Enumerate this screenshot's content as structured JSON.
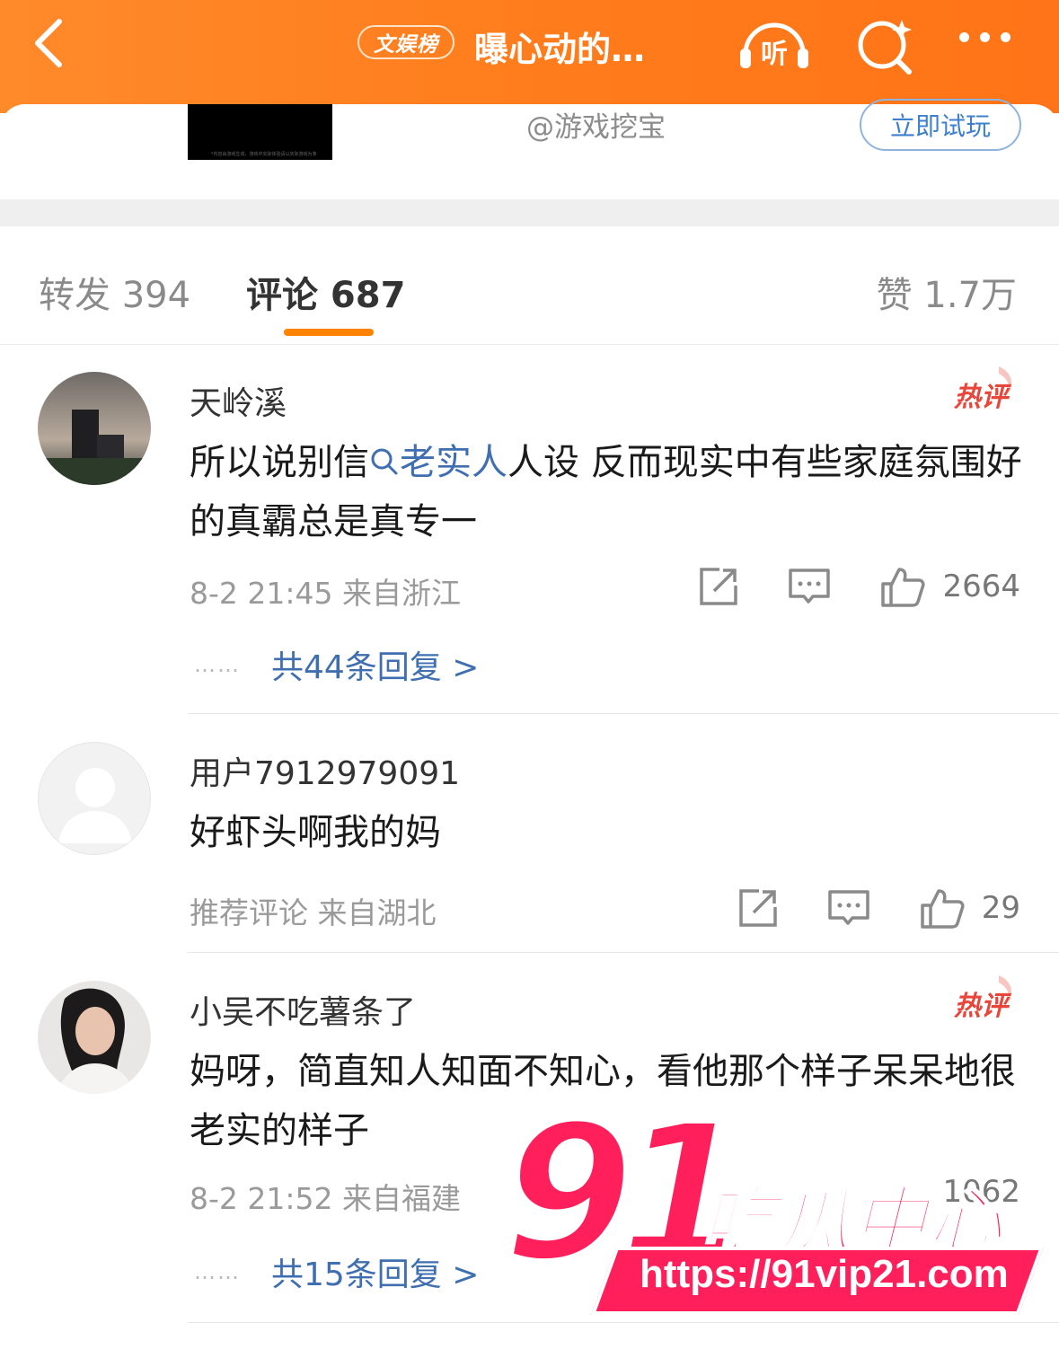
{
  "header": {
    "tag": "文娱榜",
    "title": "曝心动的…",
    "listen_icon_text": "听"
  },
  "promo": {
    "handle": "@游戏挖宝",
    "try_button": "立即试玩",
    "thumb_caption": "*内容由游戏生成，游戏中实际体验请以实际游戏为准"
  },
  "tabs": {
    "repost": "转发 394",
    "comment": "评论 687",
    "like": "赞 1.7万"
  },
  "comments": [
    {
      "user": "天岭溪",
      "hot_badge": "热评",
      "text_before": "所以说别信",
      "link_text": "老实人",
      "text_after": "人设 反而现实中有些家庭氛围好的真霸总是真专一",
      "meta": "8-2 21:45  来自浙江",
      "likes": "2664",
      "replies": "共44条回复 >"
    },
    {
      "user": "用户7912979091",
      "text": "好虾头啊我的妈",
      "meta": "推荐评论  来自湖北",
      "likes": "29"
    },
    {
      "user": "小吴不吃薯条了",
      "hot_badge": "热评",
      "text": "妈呀，简直知人知面不知心，看他那个样子呆呆地很老实的样子",
      "meta": "8-2 21:52  来自福建",
      "likes": "1062",
      "replies": "共15条回复 >"
    }
  ],
  "watermark": {
    "number": "91",
    "name": "吃瓜中心",
    "url": "https://91vip21.com"
  },
  "colors": {
    "header_orange": "#ff7a1a",
    "link_blue": "#3f6fb0",
    "hot_red": "#e8463a",
    "tab_underline": "#ff8200",
    "watermark_pink": "#ff1f5a"
  },
  "icons": [
    "back-arrow-icon",
    "listen-icon",
    "search-sparkle-icon",
    "more-icon",
    "share-icon",
    "comment-icon",
    "thumbs-up-icon",
    "search-icon"
  ]
}
